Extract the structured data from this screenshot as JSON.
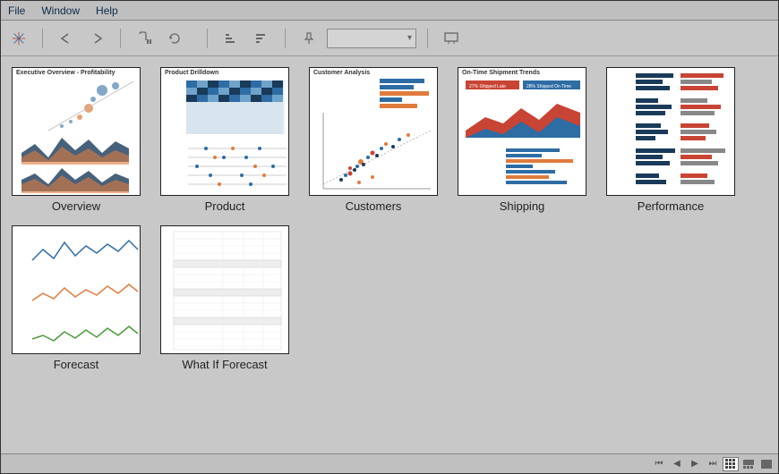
{
  "menu": {
    "file": "File",
    "window": "Window",
    "help": "Help"
  },
  "sheets": [
    {
      "label": "Overview",
      "title": "Executive Overview - Profitability"
    },
    {
      "label": "Product",
      "title": "Product Drilldown"
    },
    {
      "label": "Customers",
      "title": "Customer Analysis"
    },
    {
      "label": "Shipping",
      "title": "On-Time Shipment Trends",
      "badge1": "27% Shipped Late",
      "badge2": "28% Shipped On Time"
    },
    {
      "label": "Performance",
      "title": ""
    },
    {
      "label": "Forecast",
      "title": ""
    },
    {
      "label": "What If Forecast",
      "title": ""
    }
  ],
  "colors": {
    "blue": "#2e6ca4",
    "orange": "#e07b3c",
    "red": "#c84434",
    "darkblue": "#1a3a5a",
    "green": "#4a9a3a",
    "gray": "#888888"
  }
}
